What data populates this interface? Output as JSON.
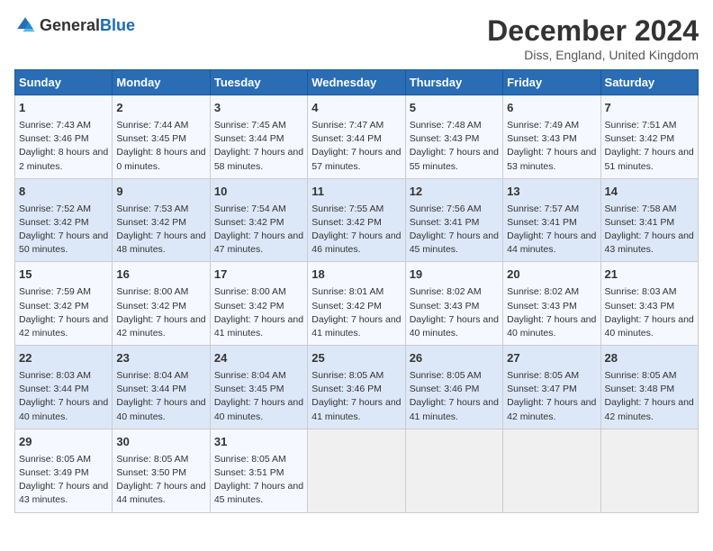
{
  "logo": {
    "general": "General",
    "blue": "Blue"
  },
  "title": "December 2024",
  "location": "Diss, England, United Kingdom",
  "days_of_week": [
    "Sunday",
    "Monday",
    "Tuesday",
    "Wednesday",
    "Thursday",
    "Friday",
    "Saturday"
  ],
  "weeks": [
    [
      {
        "day": "1",
        "sunrise": "Sunrise: 7:43 AM",
        "sunset": "Sunset: 3:46 PM",
        "daylight": "Daylight: 8 hours and 2 minutes."
      },
      {
        "day": "2",
        "sunrise": "Sunrise: 7:44 AM",
        "sunset": "Sunset: 3:45 PM",
        "daylight": "Daylight: 8 hours and 0 minutes."
      },
      {
        "day": "3",
        "sunrise": "Sunrise: 7:45 AM",
        "sunset": "Sunset: 3:44 PM",
        "daylight": "Daylight: 7 hours and 58 minutes."
      },
      {
        "day": "4",
        "sunrise": "Sunrise: 7:47 AM",
        "sunset": "Sunset: 3:44 PM",
        "daylight": "Daylight: 7 hours and 57 minutes."
      },
      {
        "day": "5",
        "sunrise": "Sunrise: 7:48 AM",
        "sunset": "Sunset: 3:43 PM",
        "daylight": "Daylight: 7 hours and 55 minutes."
      },
      {
        "day": "6",
        "sunrise": "Sunrise: 7:49 AM",
        "sunset": "Sunset: 3:43 PM",
        "daylight": "Daylight: 7 hours and 53 minutes."
      },
      {
        "day": "7",
        "sunrise": "Sunrise: 7:51 AM",
        "sunset": "Sunset: 3:42 PM",
        "daylight": "Daylight: 7 hours and 51 minutes."
      }
    ],
    [
      {
        "day": "8",
        "sunrise": "Sunrise: 7:52 AM",
        "sunset": "Sunset: 3:42 PM",
        "daylight": "Daylight: 7 hours and 50 minutes."
      },
      {
        "day": "9",
        "sunrise": "Sunrise: 7:53 AM",
        "sunset": "Sunset: 3:42 PM",
        "daylight": "Daylight: 7 hours and 48 minutes."
      },
      {
        "day": "10",
        "sunrise": "Sunrise: 7:54 AM",
        "sunset": "Sunset: 3:42 PM",
        "daylight": "Daylight: 7 hours and 47 minutes."
      },
      {
        "day": "11",
        "sunrise": "Sunrise: 7:55 AM",
        "sunset": "Sunset: 3:42 PM",
        "daylight": "Daylight: 7 hours and 46 minutes."
      },
      {
        "day": "12",
        "sunrise": "Sunrise: 7:56 AM",
        "sunset": "Sunset: 3:41 PM",
        "daylight": "Daylight: 7 hours and 45 minutes."
      },
      {
        "day": "13",
        "sunrise": "Sunrise: 7:57 AM",
        "sunset": "Sunset: 3:41 PM",
        "daylight": "Daylight: 7 hours and 44 minutes."
      },
      {
        "day": "14",
        "sunrise": "Sunrise: 7:58 AM",
        "sunset": "Sunset: 3:41 PM",
        "daylight": "Daylight: 7 hours and 43 minutes."
      }
    ],
    [
      {
        "day": "15",
        "sunrise": "Sunrise: 7:59 AM",
        "sunset": "Sunset: 3:42 PM",
        "daylight": "Daylight: 7 hours and 42 minutes."
      },
      {
        "day": "16",
        "sunrise": "Sunrise: 8:00 AM",
        "sunset": "Sunset: 3:42 PM",
        "daylight": "Daylight: 7 hours and 42 minutes."
      },
      {
        "day": "17",
        "sunrise": "Sunrise: 8:00 AM",
        "sunset": "Sunset: 3:42 PM",
        "daylight": "Daylight: 7 hours and 41 minutes."
      },
      {
        "day": "18",
        "sunrise": "Sunrise: 8:01 AM",
        "sunset": "Sunset: 3:42 PM",
        "daylight": "Daylight: 7 hours and 41 minutes."
      },
      {
        "day": "19",
        "sunrise": "Sunrise: 8:02 AM",
        "sunset": "Sunset: 3:43 PM",
        "daylight": "Daylight: 7 hours and 40 minutes."
      },
      {
        "day": "20",
        "sunrise": "Sunrise: 8:02 AM",
        "sunset": "Sunset: 3:43 PM",
        "daylight": "Daylight: 7 hours and 40 minutes."
      },
      {
        "day": "21",
        "sunrise": "Sunrise: 8:03 AM",
        "sunset": "Sunset: 3:43 PM",
        "daylight": "Daylight: 7 hours and 40 minutes."
      }
    ],
    [
      {
        "day": "22",
        "sunrise": "Sunrise: 8:03 AM",
        "sunset": "Sunset: 3:44 PM",
        "daylight": "Daylight: 7 hours and 40 minutes."
      },
      {
        "day": "23",
        "sunrise": "Sunrise: 8:04 AM",
        "sunset": "Sunset: 3:44 PM",
        "daylight": "Daylight: 7 hours and 40 minutes."
      },
      {
        "day": "24",
        "sunrise": "Sunrise: 8:04 AM",
        "sunset": "Sunset: 3:45 PM",
        "daylight": "Daylight: 7 hours and 40 minutes."
      },
      {
        "day": "25",
        "sunrise": "Sunrise: 8:05 AM",
        "sunset": "Sunset: 3:46 PM",
        "daylight": "Daylight: 7 hours and 41 minutes."
      },
      {
        "day": "26",
        "sunrise": "Sunrise: 8:05 AM",
        "sunset": "Sunset: 3:46 PM",
        "daylight": "Daylight: 7 hours and 41 minutes."
      },
      {
        "day": "27",
        "sunrise": "Sunrise: 8:05 AM",
        "sunset": "Sunset: 3:47 PM",
        "daylight": "Daylight: 7 hours and 42 minutes."
      },
      {
        "day": "28",
        "sunrise": "Sunrise: 8:05 AM",
        "sunset": "Sunset: 3:48 PM",
        "daylight": "Daylight: 7 hours and 42 minutes."
      }
    ],
    [
      {
        "day": "29",
        "sunrise": "Sunrise: 8:05 AM",
        "sunset": "Sunset: 3:49 PM",
        "daylight": "Daylight: 7 hours and 43 minutes."
      },
      {
        "day": "30",
        "sunrise": "Sunrise: 8:05 AM",
        "sunset": "Sunset: 3:50 PM",
        "daylight": "Daylight: 7 hours and 44 minutes."
      },
      {
        "day": "31",
        "sunrise": "Sunrise: 8:05 AM",
        "sunset": "Sunset: 3:51 PM",
        "daylight": "Daylight: 7 hours and 45 minutes."
      },
      null,
      null,
      null,
      null
    ]
  ]
}
